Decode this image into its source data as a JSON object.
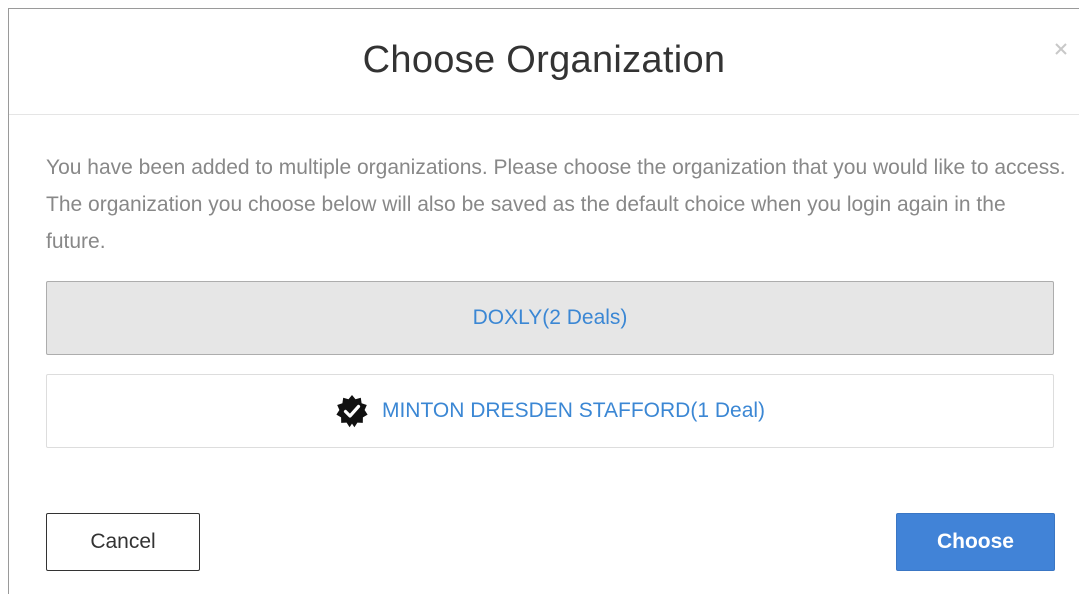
{
  "dialog": {
    "title": "Choose Organization",
    "close_label": "×",
    "description": "You have been added to multiple organizations. Please choose the organization that you would like to access. The organization you choose below will also be saved as the default choice when you login again in the future.",
    "organizations": [
      {
        "label": "DOXLY(2 Deals)",
        "selected": true,
        "verified": false
      },
      {
        "label": "MINTON DRESDEN STAFFORD(1 Deal)",
        "selected": false,
        "verified": true
      }
    ],
    "cancel_label": "Cancel",
    "choose_label": "Choose"
  },
  "colors": {
    "accent": "#4183d7",
    "link": "#3b87d4",
    "selected_bg": "#e6e6e6",
    "description_text": "#888888"
  },
  "icons": {
    "close": "close-icon",
    "verified": "verified-badge-icon"
  }
}
